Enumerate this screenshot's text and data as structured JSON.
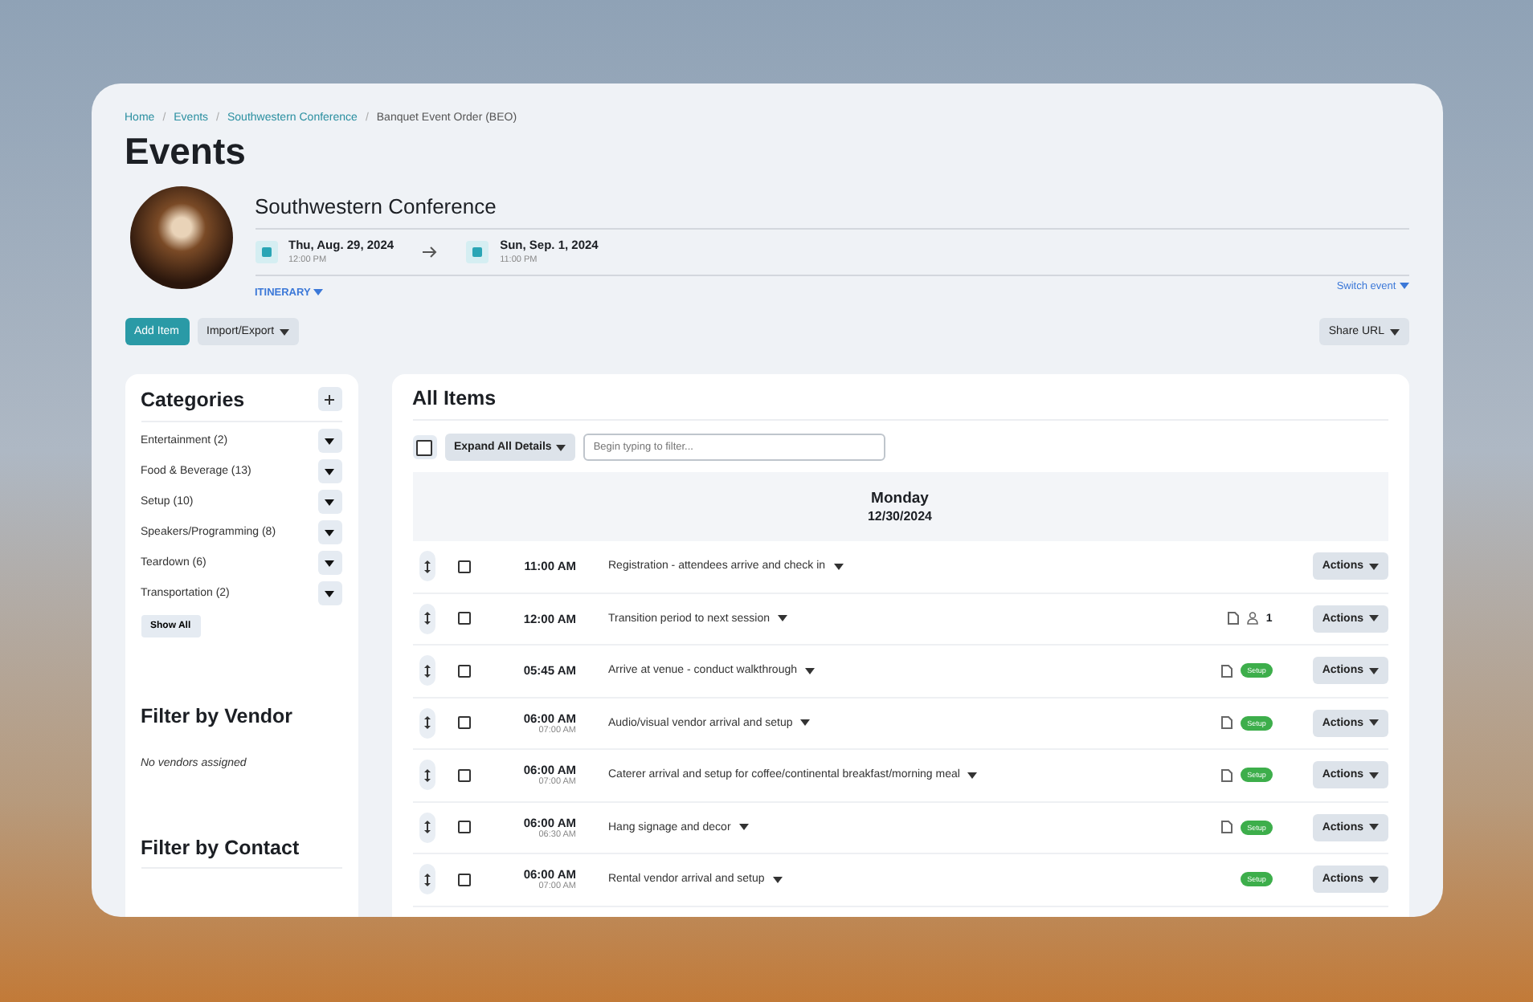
{
  "breadcrumb": [
    {
      "kind": "link",
      "label": "Home"
    },
    {
      "kind": "separator",
      "label": "/"
    },
    {
      "kind": "link",
      "label": "Events"
    },
    {
      "kind": "separator",
      "label": "/"
    },
    {
      "kind": "link",
      "label": "Southwestern Conference"
    },
    {
      "kind": "separator",
      "label": "/"
    },
    {
      "kind": "current",
      "label": "Banquet Event Order (BEO)"
    }
  ],
  "page_title": "Events",
  "event": {
    "name": "Southwestern Conference",
    "start": {
      "date": "Thu, Aug. 29, 2024",
      "time": "12:00 PM"
    },
    "end": {
      "date": "Sun, Sep. 1, 2024",
      "time": "11:00 PM"
    },
    "itinerary": "ITINERARY",
    "switch": "Switch event"
  },
  "actions": {
    "add": "Add Item",
    "import": "Import/Export",
    "share": "Share URL"
  },
  "categories": {
    "title": "Categories",
    "items": [
      "Entertainment (2)",
      "Food & Beverage (13)",
      "Setup (10)",
      "Speakers/Programming (8)",
      "Teardown (6)",
      "Transportation (2)"
    ],
    "show_all": "Show All"
  },
  "vendor": {
    "title": "Filter by Vendor",
    "empty": "No vendors assigned"
  },
  "contact": {
    "title": "Filter by Contact"
  },
  "items": {
    "title": "All Items",
    "select_all_checked": false,
    "expand": "Expand All Details",
    "filter_placeholder": "Begin typing to filter...",
    "day": "Monday",
    "date": "12/30/2024",
    "rows": [
      {
        "time": "11:00 AM",
        "title": "Registration - attendees arrive and check in",
        "checked": false,
        "doc": false,
        "actions": "Actions"
      },
      {
        "time": "12:00 AM",
        "title": "Transition period to next session",
        "checked": false,
        "doc": true,
        "contacts": "1",
        "actions": "Actions"
      },
      {
        "time": "05:45 AM",
        "title": "Arrive at venue - conduct walkthrough",
        "checked": false,
        "doc": true,
        "tag": "Setup",
        "actions": "Actions"
      },
      {
        "time": "06:00 AM",
        "end": "07:00 AM",
        "title": "Audio/visual vendor arrival and setup",
        "checked": false,
        "doc": true,
        "tag": "Setup",
        "actions": "Actions"
      },
      {
        "time": "06:00 AM",
        "end": "07:00 AM",
        "title": "Caterer arrival and setup for coffee/continental breakfast/morning meal",
        "checked": false,
        "doc": true,
        "tag": "Setup",
        "actions": "Actions"
      },
      {
        "time": "06:00 AM",
        "end": "06:30 AM",
        "title": "Hang signage and decor",
        "checked": false,
        "doc": true,
        "tag": "Setup",
        "actions": "Actions"
      },
      {
        "time": "06:00 AM",
        "end": "07:00 AM",
        "title": "Rental vendor arrival and setup",
        "checked": false,
        "doc": false,
        "tag": "Setup",
        "actions": "Actions"
      }
    ]
  }
}
